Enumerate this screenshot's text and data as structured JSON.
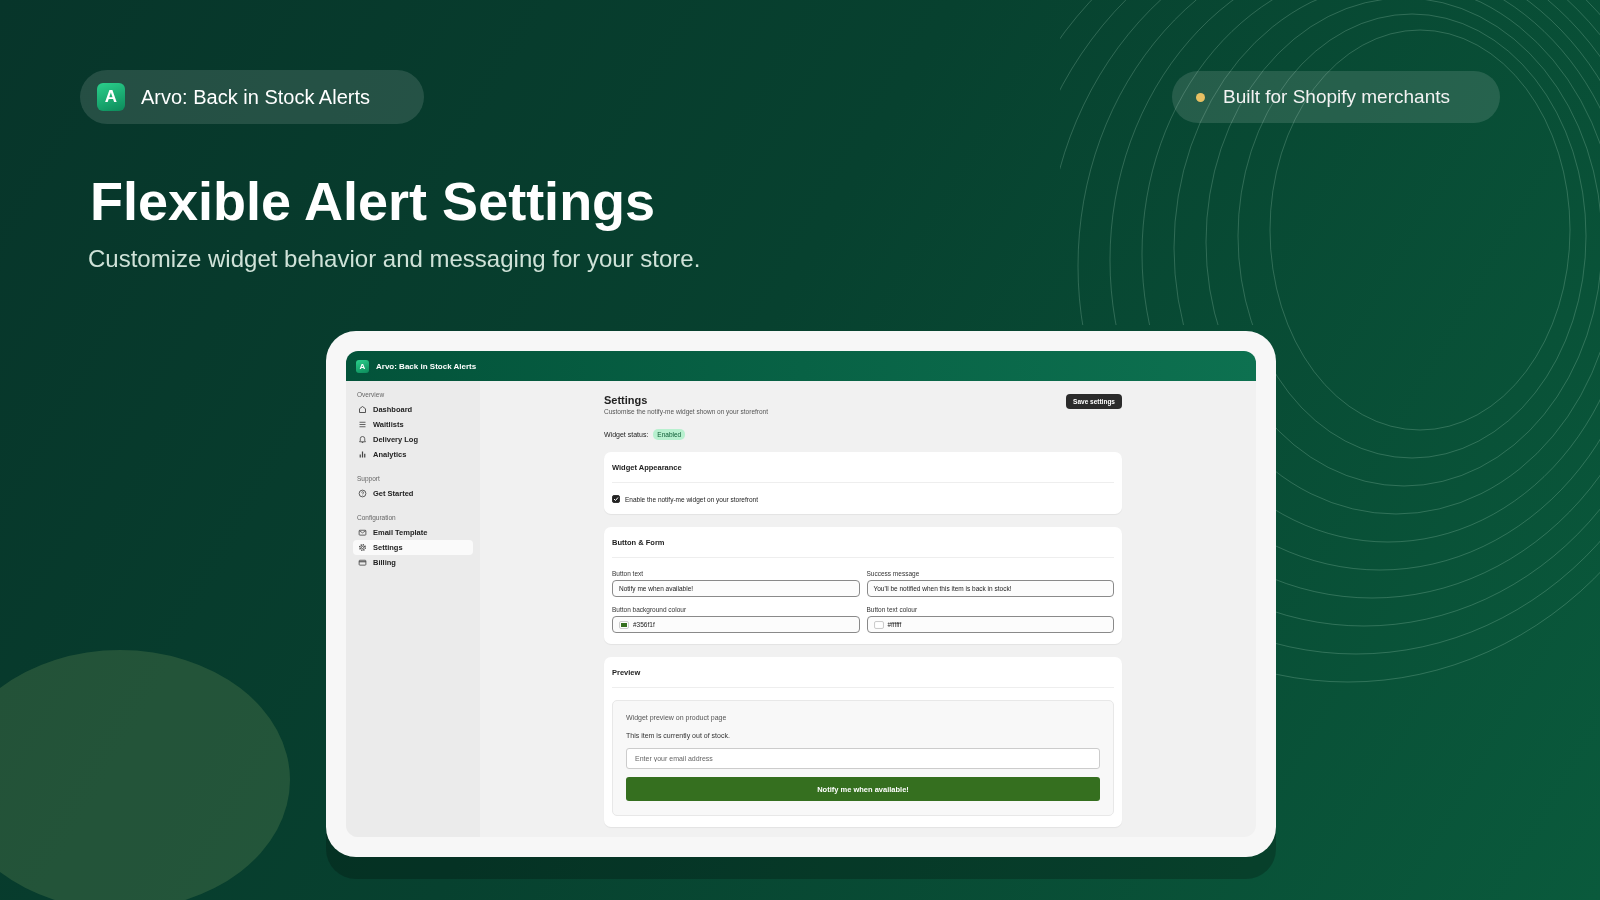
{
  "brand": {
    "logo": "A",
    "name": "Arvo: Back in Stock Alerts"
  },
  "tagline": "Built for Shopify merchants",
  "headline": "Flexible Alert Settings",
  "subheadline": "Customize widget behavior and messaging for your store.",
  "app": {
    "header": {
      "logo": "A",
      "title": "Arvo: Back in Stock Alerts"
    },
    "sidebar": [
      {
        "heading": "Overview",
        "items": [
          {
            "label": "Dashboard",
            "selected": false
          },
          {
            "label": "Waitlists",
            "selected": false
          },
          {
            "label": "Delivery Log",
            "selected": false
          },
          {
            "label": "Analytics",
            "selected": false
          }
        ]
      },
      {
        "heading": "Support",
        "items": [
          {
            "label": "Get Started",
            "selected": false
          }
        ]
      },
      {
        "heading": "Configuration",
        "items": [
          {
            "label": "Email Template",
            "selected": false
          },
          {
            "label": "Settings",
            "selected": true
          },
          {
            "label": "Billing",
            "selected": false
          }
        ]
      }
    ],
    "page": {
      "title": "Settings",
      "subtitle": "Customise the notify-me widget shown on your storefront",
      "save_button": "Save settings",
      "status_label": "Widget status:",
      "status_badge": "Enabled",
      "cards": [
        {
          "kind": "checkbox",
          "title": "Widget Appearance",
          "checkbox": {
            "label": "Enable the notify-me widget on your storefront",
            "checked": true
          }
        },
        {
          "kind": "form",
          "title": "Button & Form",
          "fields": [
            {
              "kind": "text",
              "label": "Button text",
              "value": "Notify me when available!"
            },
            {
              "kind": "text",
              "label": "Success message",
              "value": "You'll be notified when this item is back in stock!"
            },
            {
              "kind": "color",
              "label": "Button background colour",
              "value": "#356f1f"
            },
            {
              "kind": "color",
              "label": "Button text colour",
              "value": "#ffffff"
            }
          ]
        },
        {
          "kind": "preview",
          "title": "Preview",
          "caption": "Widget preview on product page",
          "message": "This item is currently out of stock.",
          "email_placeholder": "Enter your email address",
          "button": "Notify me when available!"
        }
      ]
    }
  }
}
